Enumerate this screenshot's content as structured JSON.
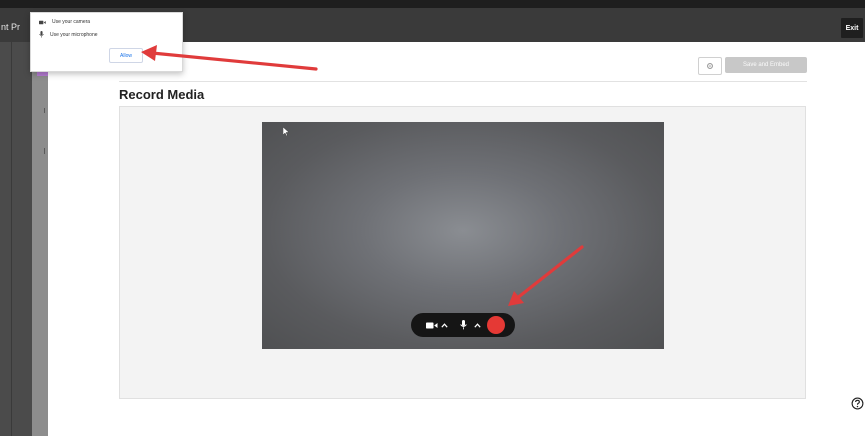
{
  "topbar": {
    "title_fragment": "nt Pr",
    "exit_label": "Exit"
  },
  "permission_popup": {
    "camera_label": "Use your camera",
    "microphone_label": "Use your microphone",
    "allow_label": "Allow"
  },
  "toolbar": {
    "save_embed_label": "Save and Embed"
  },
  "page": {
    "title": "Record Media"
  },
  "colors": {
    "record_button": "#e53935",
    "annotation_arrow": "#e03b3b",
    "topbar": "#3a3a3a",
    "accent_purple": "#b57bd2"
  },
  "icons": {
    "camera": "video-camera-icon",
    "microphone": "microphone-icon",
    "settings": "gear-icon",
    "help": "help-icon",
    "chevron": "chevron-up-icon"
  }
}
